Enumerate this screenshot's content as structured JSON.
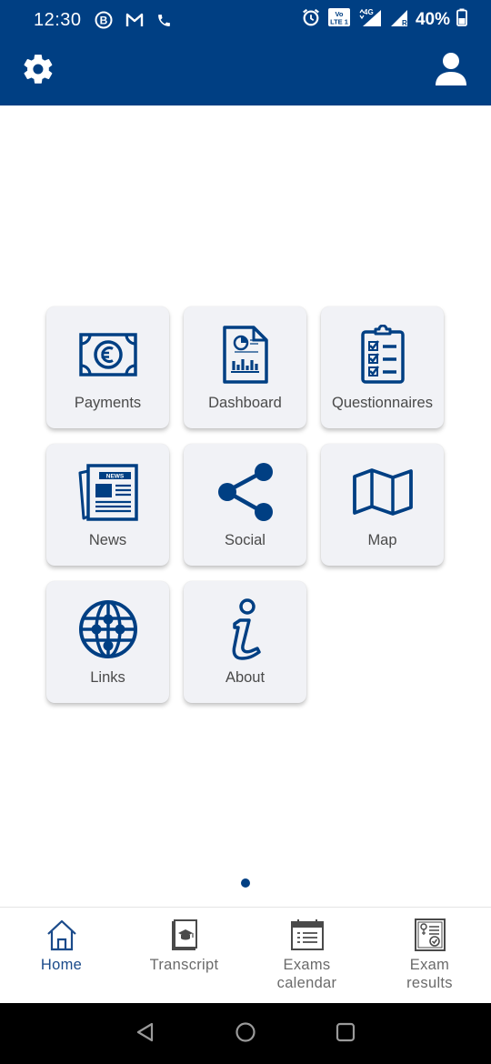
{
  "status_bar": {
    "time": "12:30",
    "battery": "40%",
    "icons": [
      "b-circle-icon",
      "gmail-icon",
      "phone-icon",
      "alarm-icon",
      "volte-icon",
      "4g-signal-icon",
      "signal-r-icon",
      "battery-icon"
    ]
  },
  "toolbar": {
    "settings_icon": "gear-icon",
    "profile_icon": "user-icon",
    "background": "#003f83"
  },
  "grid": {
    "tiles": [
      {
        "label": "Payments",
        "icon": "euro-banknote-icon"
      },
      {
        "label": "Dashboard",
        "icon": "report-document-icon"
      },
      {
        "label": "Questionnaires",
        "icon": "checklist-clipboard-icon"
      },
      {
        "label": "News",
        "icon": "newspaper-icon"
      },
      {
        "label": "Social",
        "icon": "share-icon"
      },
      {
        "label": "Map",
        "icon": "folded-map-icon"
      },
      {
        "label": "Links",
        "icon": "globe-network-icon"
      },
      {
        "label": "About",
        "icon": "info-icon"
      }
    ]
  },
  "pager": {
    "pages": 1,
    "current": 1
  },
  "bottom_nav": {
    "items": [
      {
        "label": "Home",
        "icon": "home-icon",
        "active": true
      },
      {
        "label": "Transcript",
        "icon": "transcript-book-icon",
        "active": false
      },
      {
        "label": "Exams\ncalendar",
        "icon": "calendar-list-icon",
        "active": false
      },
      {
        "label": "Exam\nresults",
        "icon": "certificate-icon",
        "active": false
      }
    ]
  },
  "colors": {
    "accent": "#003f83",
    "tile_bg": "#f1f2f6",
    "label": "#4a4a4a"
  }
}
